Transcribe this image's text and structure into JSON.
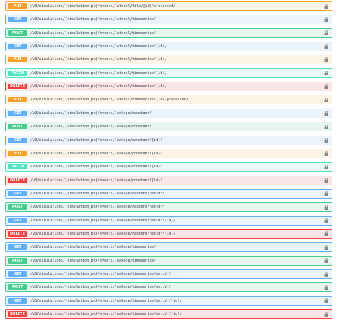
{
  "method_colors": {
    "PUT": "#fca130",
    "GET": "#61affe",
    "POST": "#49cc90",
    "PATCH": "#50e3c2",
    "DELETE": "#f93e3e"
  },
  "lock_icon": "lock-icon",
  "operations": [
    {
      "method": "PUT",
      "path": "/v3/simulations/{simulation_pk}/events/lateral/file/{id}/processed/"
    },
    {
      "method": "GET",
      "path": "/v3/simulations/{simulation_pk}/events/lateral/timeseries/"
    },
    {
      "method": "POST",
      "path": "/v3/simulations/{simulation_pk}/events/lateral/timeseries/"
    },
    {
      "method": "GET",
      "path": "/v3/simulations/{simulation_pk}/events/lateral/timeseries/{id}/"
    },
    {
      "method": "PUT",
      "path": "/v3/simulations/{simulation_pk}/events/lateral/timeseries/{id}/"
    },
    {
      "method": "PATCH",
      "path": "/v3/simulations/{simulation_pk}/events/lateral/timeseries/{id}/"
    },
    {
      "method": "DELETE",
      "path": "/v3/simulations/{simulation_pk}/events/lateral/timeseries/{id}/"
    },
    {
      "method": "PUT",
      "path": "/v3/simulations/{simulation_pk}/events/lateral/timeseries/{id}/processed/"
    },
    {
      "method": "GET",
      "path": "/v3/simulations/{simulation_pk}/events/leakage/constant/"
    },
    {
      "method": "POST",
      "path": "/v3/simulations/{simulation_pk}/events/leakage/constant/"
    },
    {
      "method": "GET",
      "path": "/v3/simulations/{simulation_pk}/events/leakage/constant/{id}/"
    },
    {
      "method": "PUT",
      "path": "/v3/simulations/{simulation_pk}/events/leakage/constant/{id}/"
    },
    {
      "method": "PATCH",
      "path": "/v3/simulations/{simulation_pk}/events/leakage/constant/{id}/"
    },
    {
      "method": "DELETE",
      "path": "/v3/simulations/{simulation_pk}/events/leakage/constant/{id}/"
    },
    {
      "method": "GET",
      "path": "/v3/simulations/{simulation_pk}/events/leakage/rasters/netcdf/"
    },
    {
      "method": "POST",
      "path": "/v3/simulations/{simulation_pk}/events/leakage/rasters/netcdf/"
    },
    {
      "method": "GET",
      "path": "/v3/simulations/{simulation_pk}/events/leakage/rasters/netcdf/{id}/"
    },
    {
      "method": "DELETE",
      "path": "/v3/simulations/{simulation_pk}/events/leakage/rasters/netcdf/{id}/"
    },
    {
      "method": "GET",
      "path": "/v3/simulations/{simulation_pk}/events/leakage/timeseries/"
    },
    {
      "method": "POST",
      "path": "/v3/simulations/{simulation_pk}/events/leakage/timeseries/"
    },
    {
      "method": "GET",
      "path": "/v3/simulations/{simulation_pk}/events/leakage/timeseries/netcdf/"
    },
    {
      "method": "POST",
      "path": "/v3/simulations/{simulation_pk}/events/leakage/timeseries/netcdf/"
    },
    {
      "method": "GET",
      "path": "/v3/simulations/{simulation_pk}/events/leakage/timeseries/netcdf/{id}/"
    },
    {
      "method": "DELETE",
      "path": "/v3/simulations/{simulation_pk}/events/leakage/timeseries/netcdf/{id}/"
    }
  ]
}
